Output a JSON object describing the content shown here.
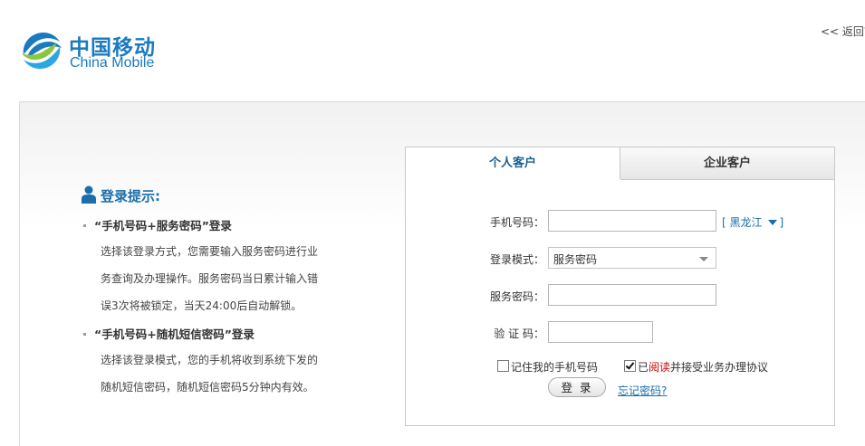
{
  "logo": {
    "cn": "中国移动",
    "en": "China Mobile",
    "color": "#1a7abf"
  },
  "header": {
    "back_link": "<< 返回首"
  },
  "tips": {
    "title": "登录提示:",
    "items": [
      {
        "heading": "“手机号码+服务密码”登录",
        "lines": [
          "选择该登录方式，您需要输入服务密码进行业",
          "务查询及办理操作。服务密码当日累计输入错",
          "误3次将被锁定，当天24:00后自动解锁。"
        ]
      },
      {
        "heading": "“手机号码+随机短信密码”登录",
        "lines": [
          "选择该登录模式，您的手机将收到系统下发的",
          "随机短信密码，随机短信密码5分钟内有效。"
        ]
      }
    ]
  },
  "tabs": [
    {
      "label": "个人客户",
      "active": true
    },
    {
      "label": "企业客户",
      "active": false
    }
  ],
  "form": {
    "phone_label": "手机号码：",
    "phone_value": "",
    "region_label": "[ 黑龙江",
    "region_close": "]",
    "mode_label": "登录模式：",
    "mode_value": "服务密码",
    "password_label": "服务密码：",
    "password_value": "",
    "captcha_label": "验 证 码：",
    "captcha_value": "",
    "remember_label": "记住我的手机号码",
    "remember_checked": false,
    "agree_prefix": "已",
    "agree_read": "阅读",
    "agree_suffix": "并接受业务办理协议",
    "agree_checked": true,
    "login_button": "登录",
    "forgot_link": "忘记密码?"
  },
  "colors": {
    "accent": "#1a6eaa",
    "brand": "#1a7abf",
    "warn": "#cc0000"
  }
}
